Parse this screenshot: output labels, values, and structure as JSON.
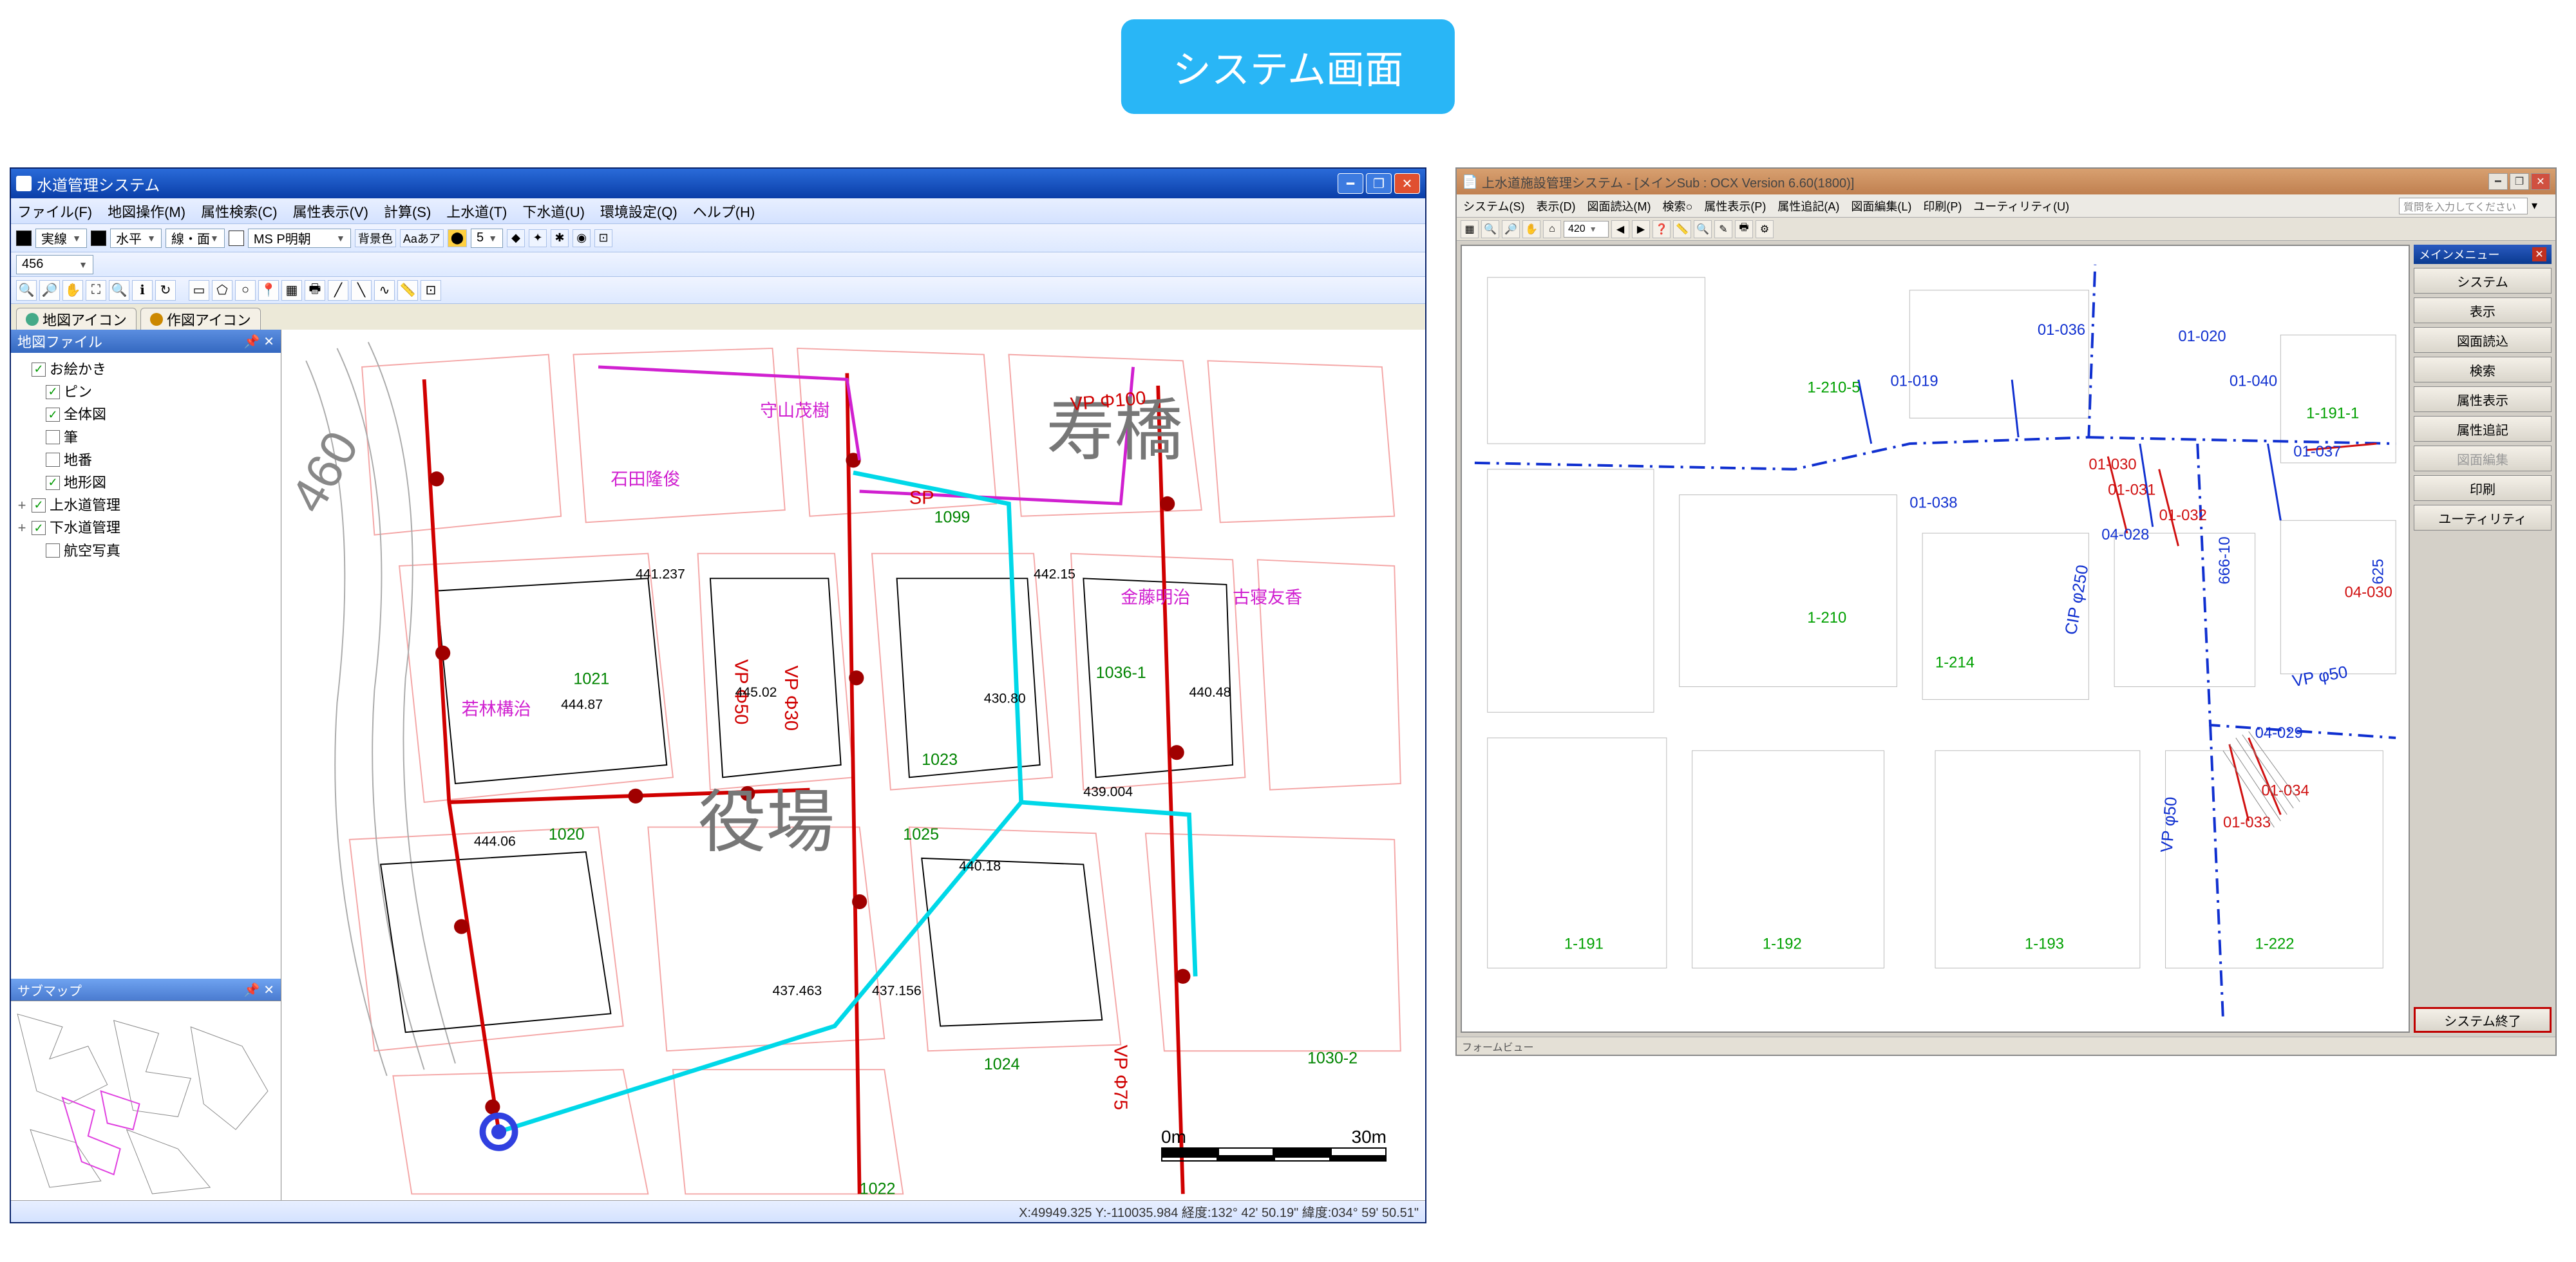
{
  "header_badge": "システム画面",
  "win1": {
    "title": "水道管理システム",
    "menu": [
      "ファイル(F)",
      "地図操作(M)",
      "属性検索(C)",
      "属性表示(V)",
      "計算(S)",
      "上水道(T)",
      "下水道(U)",
      "環境設定(Q)",
      "ヘルプ(H)"
    ],
    "toolbar1": {
      "line_style": "実線",
      "direction": "水平",
      "fill_mode": "線・面",
      "font": "MS P明朝",
      "bg_label": "背景色",
      "aa_label": "Aaあア",
      "num_val": "5"
    },
    "toolbar1_select": "456",
    "tabs": [
      "地図アイコン",
      "作図アイコン"
    ],
    "sidebar": {
      "panel_title": "地図ファイル",
      "tree": [
        {
          "exp": "",
          "checked": true,
          "label": "お絵かき"
        },
        {
          "exp": "",
          "checked": true,
          "label": "ピン",
          "indent": 1
        },
        {
          "exp": "",
          "checked": true,
          "label": "全体図",
          "indent": 1
        },
        {
          "exp": "",
          "checked": false,
          "label": "筆",
          "indent": 1
        },
        {
          "exp": "",
          "checked": false,
          "label": "地番",
          "indent": 1
        },
        {
          "exp": "",
          "checked": true,
          "label": "地形図",
          "indent": 1
        },
        {
          "exp": "+",
          "checked": true,
          "label": "上水道管理",
          "indent": 0
        },
        {
          "exp": "+",
          "checked": true,
          "label": "下水道管理",
          "indent": 0
        },
        {
          "exp": "",
          "checked": false,
          "label": "航空写真",
          "indent": 1
        }
      ],
      "submap_title": "サブマップ"
    },
    "map": {
      "big_labels": [
        "寿橋",
        "役場"
      ],
      "contour_label": "460",
      "pipe_labels": [
        "VP Φ100",
        "VP Φ50",
        "VP Φ75",
        "SP",
        "VP Φ30"
      ],
      "lot_numbers": [
        "1021",
        "1020",
        "1022",
        "1023",
        "1024",
        "1025",
        "1036-1",
        "1099",
        "1030-2"
      ],
      "elev_samples": [
        "444.06",
        "444.87",
        "445.02",
        "430.80",
        "442.15",
        "440.48",
        "440.18",
        "439.004",
        "441.237",
        "437.463",
        "437.156"
      ],
      "owner_samples": [
        "若林構治",
        "石田隆俊",
        "守山茂樹",
        "金藤明治",
        "古寝友香"
      ],
      "scale": {
        "left": "0m",
        "right": "30m"
      }
    },
    "status": "X:49949.325 Y:-110035.984  経度:132° 42' 50.19\"  緯度:034° 59' 50.51\""
  },
  "win2": {
    "title": "上水道施設管理システム - [メインSub : OCX Version 6.60(1800)]",
    "menu": [
      "システム(S)",
      "表示(D)",
      "図面読込(M)",
      "検索○",
      "属性表示(P)",
      "属性追記(A)",
      "図面編集(L)",
      "印刷(P)",
      "ユーティリティ(U)"
    ],
    "search_placeholder": "質問を入力してください",
    "toolbar_combo": "420",
    "rightpanel": {
      "head": "メインメニュー",
      "buttons": [
        {
          "label": "システム",
          "disabled": false
        },
        {
          "label": "表示",
          "disabled": false
        },
        {
          "label": "図面読込",
          "disabled": false
        },
        {
          "label": "検索",
          "disabled": false
        },
        {
          "label": "属性表示",
          "disabled": false
        },
        {
          "label": "属性追記",
          "disabled": false
        },
        {
          "label": "図面編集",
          "disabled": true
        },
        {
          "label": "印刷",
          "disabled": false
        },
        {
          "label": "ユーティリティ",
          "disabled": false
        }
      ],
      "exit": "システム終了"
    },
    "status": "フォームビュー",
    "map_labels": {
      "blue_mains": [
        "CIP φ250",
        "VP φ50",
        "VP φ50"
      ],
      "green_lots": [
        "1-210-5",
        "1-210",
        "1-214",
        "1-191",
        "1-192",
        "1-193",
        "1-222",
        "1-191-1"
      ],
      "blue_ids": [
        "01-036",
        "01-019",
        "01-020",
        "01-040",
        "01-037",
        "01-038",
        "04-028",
        "666-10",
        "625",
        "04-029"
      ],
      "red_ids": [
        "01-030",
        "01-031",
        "01-032",
        "01-034",
        "01-033",
        "04-030"
      ]
    }
  }
}
